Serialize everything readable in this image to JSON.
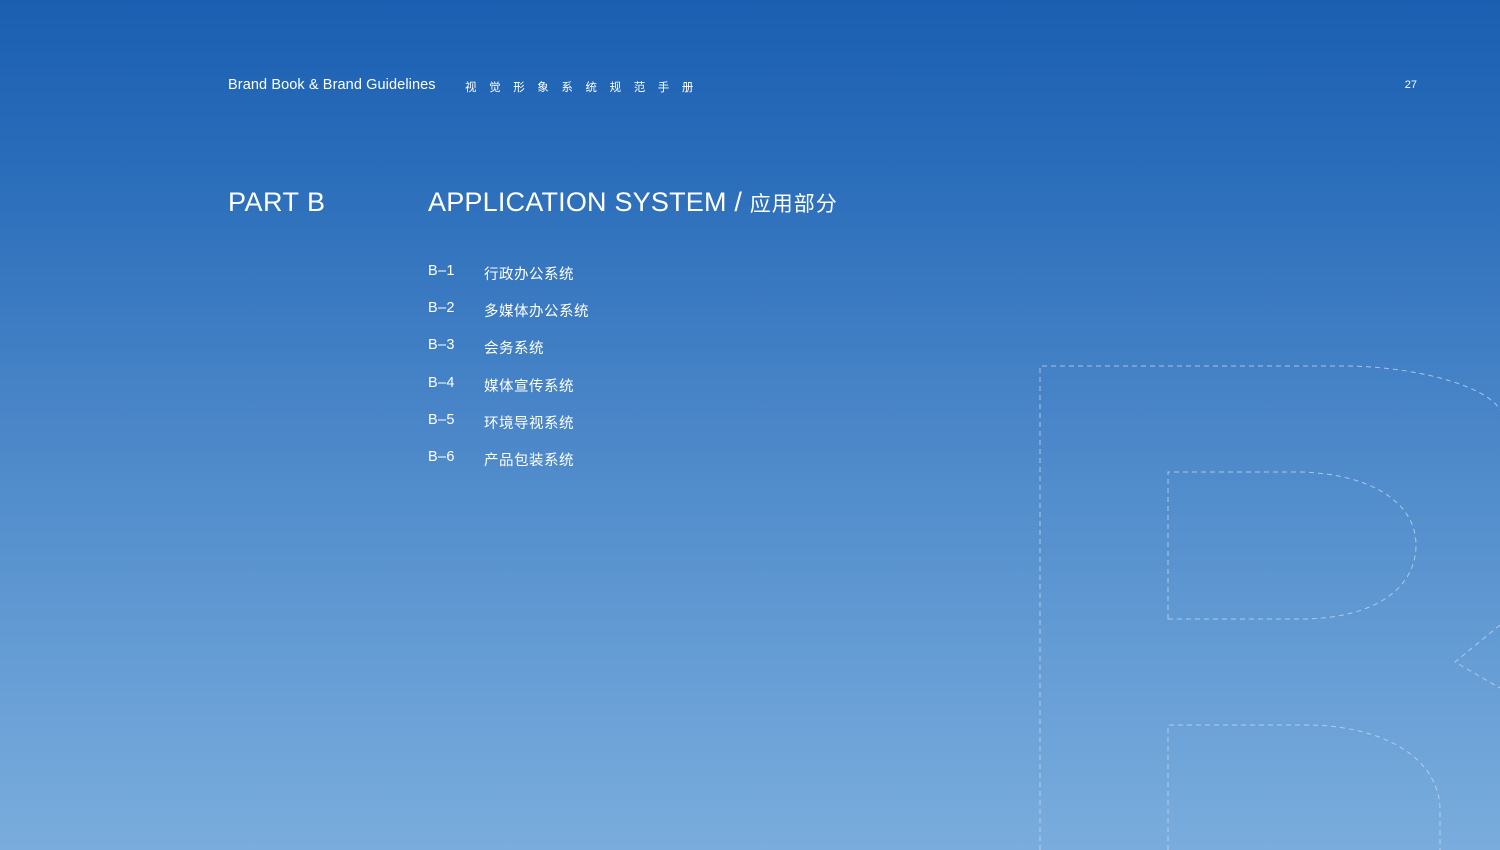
{
  "header": {
    "title": "Brand Book & Brand Guidelines",
    "subtitle": "视觉形象系统规范手册",
    "page_number": "27"
  },
  "section": {
    "part": "PART B",
    "title_en": "APPLICATION SYSTEM",
    "separator": " / ",
    "title_cn": "应用部分"
  },
  "toc": [
    {
      "code": "B–1",
      "label": "行政办公系统"
    },
    {
      "code": "B–2",
      "label": "多媒体办公系统"
    },
    {
      "code": "B–3",
      "label": "会务系统"
    },
    {
      "code": "B–4",
      "label": "媒体宣传系统"
    },
    {
      "code": "B–5",
      "label": "环境导视系统"
    },
    {
      "code": "B–6",
      "label": "产品包装系统"
    }
  ],
  "colors": {
    "background_top": "#1b5fb2",
    "background_bottom": "#7aaddd",
    "text": "#ffffff",
    "outline": "#c5dbf2"
  },
  "decoration": {
    "letter_outline_icon": "big-letter-b-dashed-outline"
  }
}
